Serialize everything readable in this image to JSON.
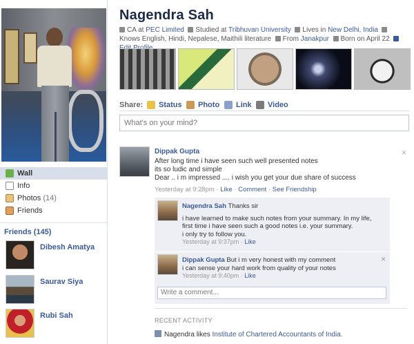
{
  "profile": {
    "name": "Nagendra Sah",
    "info": {
      "work_prefix": "CA at",
      "work_link": "PEC Limited",
      "study_prefix": "Studied at",
      "study_link": "Tribhuvan University",
      "lives_prefix": "Lives in",
      "lives_link": "New Delhi, India",
      "knows": "Knows",
      "languages": "English, Hindi, Nepalese, Maithili literature",
      "from_prefix": "From",
      "from_link": "Janakpur",
      "born": "Born on April 22",
      "edit": "Edit Profile"
    }
  },
  "nav": {
    "items": [
      {
        "label": "Wall",
        "icon": "wall-icon"
      },
      {
        "label": "Info",
        "icon": "info-icon"
      },
      {
        "label": "Photos",
        "count": "(14)",
        "icon": "photos-icon"
      },
      {
        "label": "Friends",
        "icon": "friends-icon"
      }
    ]
  },
  "friends": {
    "title": "Friends (145)",
    "list": [
      {
        "name": "Dibesh Amatya"
      },
      {
        "name": "Saurav Siya"
      },
      {
        "name": "Rubi Sah"
      }
    ]
  },
  "share": {
    "label": "Share:",
    "options": [
      "Status",
      "Photo",
      "Link",
      "Video"
    ],
    "placeholder": "What's on your mind?"
  },
  "post": {
    "author": "Dippak Gupta",
    "lines": [
      "After long time i have seen such well presented notes",
      "its so ludic and simple",
      "Dear .. i m impressed .... i wish you get your due share of success"
    ],
    "time": "Yesterday at 9:28pm",
    "actions": [
      "Like",
      "Comment",
      "See Friendship"
    ],
    "close": "×"
  },
  "comments": [
    {
      "author": "Nagendra Sah",
      "first": "Thanks sir",
      "lines": [
        "i have learned to make such notes from your summary. In my life,",
        "first time i have seen such a good notes i.e. your summary.",
        "i only try to follow you."
      ],
      "time": "Yesterday at 9:37pm",
      "like": "Like"
    },
    {
      "author": "Dippak Gupta",
      "first": "But i m very honest with my comment",
      "lines": [
        "i can sense your hard work from quality of your notes"
      ],
      "time": "Yesterday at 9:40pm",
      "like": "Like",
      "close": "×"
    }
  ],
  "write_comment": "Write a comment...",
  "recent_activity": {
    "title": "RECENT ACTIVITY",
    "text": "Nagendra likes",
    "link": "Institute of Chartered Accountants of India."
  },
  "colors": {
    "link": "#3b5998",
    "nav_active": "#d8dfea",
    "comment_bg": "#edeff4"
  }
}
